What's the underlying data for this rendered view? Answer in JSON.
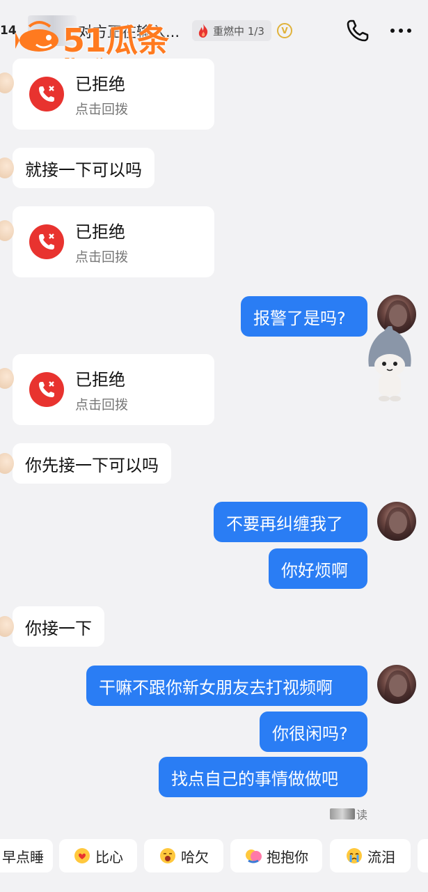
{
  "header": {
    "badge_count": "14",
    "title": "对方正在输入...",
    "title_prefix_glyph": "¦",
    "fire_status": "重燃中 1/3",
    "v_badge": "V"
  },
  "watermark": {
    "logo": "51瓜条",
    "url": "51guatiao.com"
  },
  "messages": {
    "call_card_1": {
      "title": "已拒绝",
      "subtitle": "点击回拨"
    },
    "left_1": "就接一下可以吗",
    "call_card_2": {
      "title": "已拒绝",
      "subtitle": "点击回拨"
    },
    "right_1": "报警了是吗?",
    "call_card_3": {
      "title": "已拒绝",
      "subtitle": "点击回拨"
    },
    "left_2": "你先接一下可以吗",
    "right_2": "不要再纠缠我了",
    "right_3": "你好烦啊",
    "left_3": "你接一下",
    "right_4": "干嘛不跟你新女朋友去打视频啊",
    "right_5": "你很闲吗?",
    "right_6": "找点自己的事情做做吧",
    "read_label": "读"
  },
  "quick_replies": [
    {
      "label": "早点睡",
      "icon": ""
    },
    {
      "label": "比心",
      "icon": "heart-hands-emoji"
    },
    {
      "label": "哈欠",
      "icon": "yawn-emoji"
    },
    {
      "label": "抱抱你",
      "icon": "hug-emoji"
    },
    {
      "label": "流泪",
      "icon": "crying-emoji"
    }
  ],
  "colors": {
    "blue_bubble": "#2a7df4",
    "call_red": "#e8332f",
    "background": "#f2f2f4"
  }
}
